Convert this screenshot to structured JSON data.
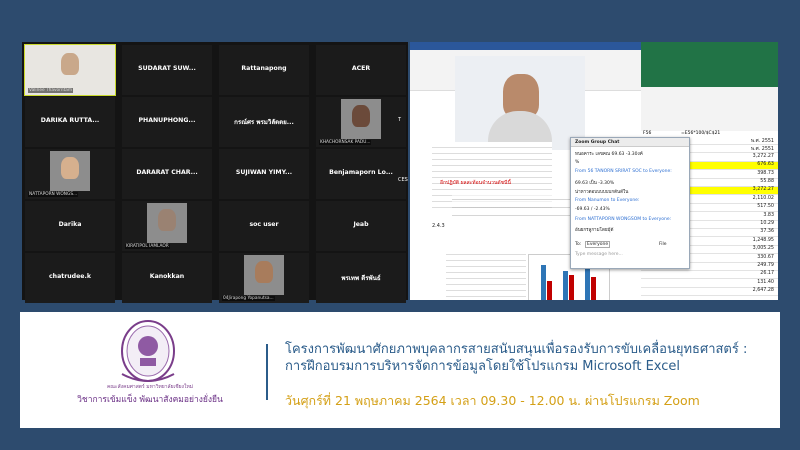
{
  "tiles": [
    {
      "name": "",
      "caption": "Valinee Thavorntam",
      "photo": true
    },
    {
      "name": "SUDARAT SUW...",
      "caption": ""
    },
    {
      "name": "Rattanapong",
      "caption": ""
    },
    {
      "name": "ACER",
      "caption": ""
    },
    {
      "name": "DARIKA RUTTA...",
      "caption": ""
    },
    {
      "name": "PHANUPHONG...",
      "caption": ""
    },
    {
      "name": "กรณ์ศร พรมวิลัดดย...",
      "caption": ""
    },
    {
      "name": "",
      "caption": "KHACHORNSAK PADU...",
      "photo": true
    },
    {
      "name": "",
      "caption": "NATTAPORN WONGS...",
      "photo": true
    },
    {
      "name": "DARARAT CHAR...",
      "caption": ""
    },
    {
      "name": "SUJIWAN YIMY...",
      "caption": ""
    },
    {
      "name": "Benjamaporn Lo...",
      "caption": ""
    },
    {
      "name": "Darika",
      "caption": ""
    },
    {
      "name": "",
      "caption": "KIRATIPOL IAMLAOR",
      "photo": true
    },
    {
      "name": "soc user",
      "caption": ""
    },
    {
      "name": "Jeab",
      "caption": ""
    },
    {
      "name": "chatrudee.k",
      "caption": ""
    },
    {
      "name": "Kanokkan",
      "caption": ""
    },
    {
      "name": "",
      "caption": "04Jirapong Yopanutsa...",
      "photo": true
    },
    {
      "name": "พรเทพ ดีรพันธ์",
      "caption": ""
    }
  ],
  "edge_labels": [
    "T",
    "CESD CM..."
  ],
  "share": {
    "speaker_caption": "Valinee Thavorntam",
    "chat": {
      "title": "Zoom Group Chat",
      "lines": [
        "หนอคาระ เลขคณ 69.63 -3.30งค์",
        "%",
        "From 56 TANORN SRIRAT SOC to Everyone:",
        "69.63 เป็น -3.30%",
        "น่าหาวตอบบบบบบกตันด์ใน",
        "From Nanumon to Everyone:",
        "-69.63 / -2.43%",
        "From NATTAPORN WONGSOM to Everyone:",
        "อันยกรลูกามโดยมุ้ตั"
      ],
      "to_label": "To:",
      "to_value": "Everyone",
      "file_label": "File",
      "placeholder": "Type message here..."
    },
    "excel_cells": [
      "พ.ศ. 2551",
      "พ.ศ. 2551",
      "3,272.27",
      "676.63",
      "398.73",
      "55.88",
      "3,272.27",
      "2,110.02",
      "517.50",
      "3.83",
      "10.29",
      "37.36",
      "1,248.95",
      "3,005.25",
      "330.67",
      "249.79",
      "26.17",
      "131.40",
      "2,647.28"
    ],
    "formula": "=E56*100/$C$21",
    "cell_ref": "F56",
    "doc_line1": "อีกปฏิบัติ ผลสะท้อนจำนวนดัชนีนี้",
    "doc_line2": "2.4.3"
  },
  "banner": {
    "title_line1": "โครงการพัฒนาศักยภาพบุคลากรสายสนับสนุนเพื่อรองรับการขับเคลื่อนยุทธศาสตร์ :",
    "title_line2": "การฝึกอบรมการบริหารจัดการข้อมูลโดยใช้โปรแกรม Microsoft Excel",
    "date_line": "วันศุกร์ที่ 21 พฤษภาคม 2564 เวลา 09.30 - 12.00 น. ผ่านโปรแกรม Zoom",
    "logo_sub1": "คณะสังคมศาสตร์ มหาวิทยาลัยเชียงใหม่",
    "logo_sub2": "วิชาการเข้มแข็ง พัฒนาสังคมอย่างยั่งยืน"
  },
  "colors": {
    "accent": "#2b5c8a",
    "date": "#d4a017",
    "logo": "#6a2f85",
    "excel": "#217346"
  }
}
